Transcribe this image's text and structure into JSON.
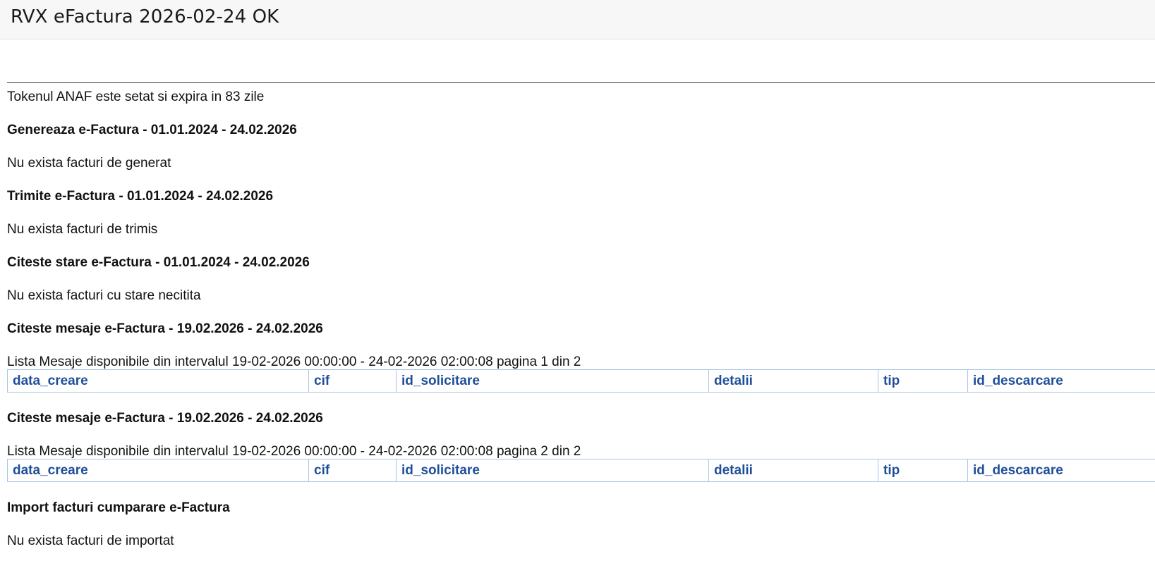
{
  "header": {
    "title": "RVX eFactura 2026-02-24 OK"
  },
  "token_status": "Tokenul ANAF este setat si expira in 83 zile",
  "sections": {
    "genereaza": {
      "heading": "Genereaza e-Factura - 01.01.2024 - 24.02.2026",
      "message": "Nu exista facturi de generat"
    },
    "trimite": {
      "heading": "Trimite e-Factura - 01.01.2024 - 24.02.2026",
      "message": "Nu exista facturi de trimis"
    },
    "stare": {
      "heading": "Citeste stare e-Factura - 01.01.2024 - 24.02.2026",
      "message": "Nu exista facturi cu stare necitita"
    },
    "mesaje_page1": {
      "heading": "Citeste mesaje e-Factura - 19.02.2026 - 24.02.2026",
      "message": "Lista Mesaje disponibile din intervalul 19-02-2026 00:00:00 - 24-02-2026 02:00:08 pagina 1 din 2",
      "columns": [
        "data_creare",
        "cif",
        "id_solicitare",
        "detalii",
        "tip",
        "id_descarcare"
      ]
    },
    "mesaje_page2": {
      "heading": "Citeste mesaje e-Factura - 19.02.2026 - 24.02.2026",
      "message": "Lista Mesaje disponibile din intervalul 19-02-2026 00:00:00 - 24-02-2026 02:00:08 pagina 2 din 2",
      "columns": [
        "data_creare",
        "cif",
        "id_solicitare",
        "detalii",
        "tip",
        "id_descarcare"
      ]
    },
    "import": {
      "heading": "Import facturi cumparare e-Factura",
      "message": "Nu exista facturi de importat"
    }
  }
}
